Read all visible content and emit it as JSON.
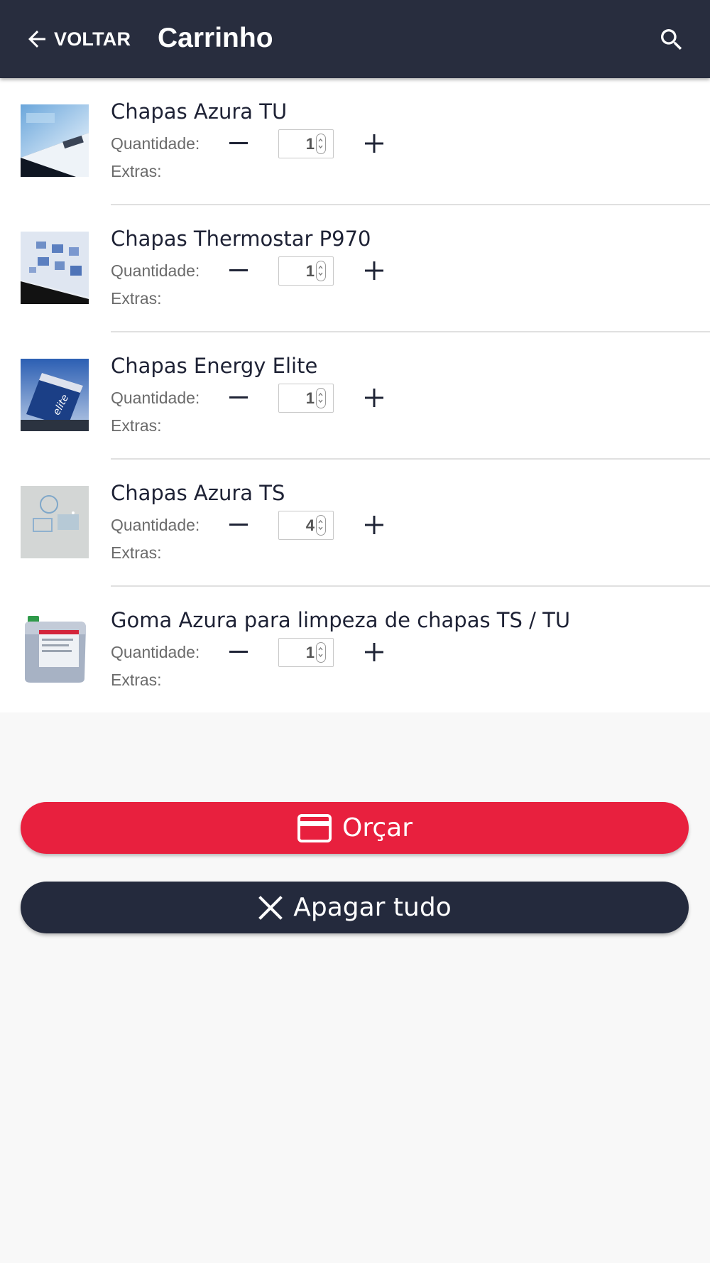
{
  "header": {
    "back_label": "VOLTAR",
    "title": "Carrinho",
    "back_icon": "arrow-left-icon",
    "search_icon": "search-icon"
  },
  "cart": {
    "quantity_label": "Quantidade:",
    "extras_label": "Extras:",
    "items": [
      {
        "name": "Chapas Azura TU",
        "quantity": "1"
      },
      {
        "name": "Chapas Thermostar P970",
        "quantity": "1"
      },
      {
        "name": "Chapas Energy Elite",
        "quantity": "1"
      },
      {
        "name": "Chapas Azura TS",
        "quantity": "4"
      },
      {
        "name": "Goma Azura para limpeza de chapas TS / TU",
        "quantity": "1"
      }
    ]
  },
  "actions": {
    "quote_label": "Orçar",
    "quote_icon": "credit-card-icon",
    "clear_label": "Apagar tudo",
    "clear_icon": "close-icon"
  },
  "colors": {
    "app_bar": "#282d3e",
    "quote_button": "#e8203e",
    "clear_button": "#242a3d",
    "page_background": "#f8f8f8"
  }
}
